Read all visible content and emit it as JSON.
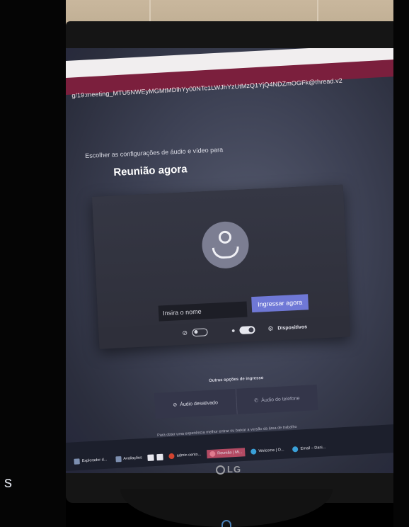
{
  "browser": {
    "url": "g/19:meeting_MTU5NWEyMGMtMDlhYy00NTc1LWJhYzUtMzQ1YjQ4NDZmOGFk@thread.v2"
  },
  "prejoin": {
    "subtitle": "Escolher as configurações de áudio e vídeo para",
    "title": "Reunião agora",
    "name_placeholder": "Insira o nome",
    "join_label": "Ingressar agora",
    "devices_label": "Dispositivos",
    "camera_on": false,
    "mic_on": true
  },
  "other_options": {
    "title": "Outras opções de ingresso",
    "audio_off_label": "Áudio desativado",
    "phone_audio_label": "Áudio do telefone"
  },
  "footnote": "Para obter uma experiência melhor entrar ou baixar a versão da área de trabalho",
  "taskbar": {
    "items": [
      {
        "label": "Explorador d..."
      },
      {
        "label": "Avaliações"
      },
      {
        "label": "admin cento..."
      },
      {
        "label": "Reunião | Mi..."
      },
      {
        "label": "Welcome | O..."
      },
      {
        "label": "Email – Dani..."
      }
    ]
  },
  "monitor": {
    "brand": "LG"
  },
  "edge_char": "s",
  "colors": {
    "teams_bar": "#7b1f3d",
    "join_button": "#6f78d6",
    "card_bg": "#2e2f3a",
    "taskbar_active": "#b34a63"
  }
}
